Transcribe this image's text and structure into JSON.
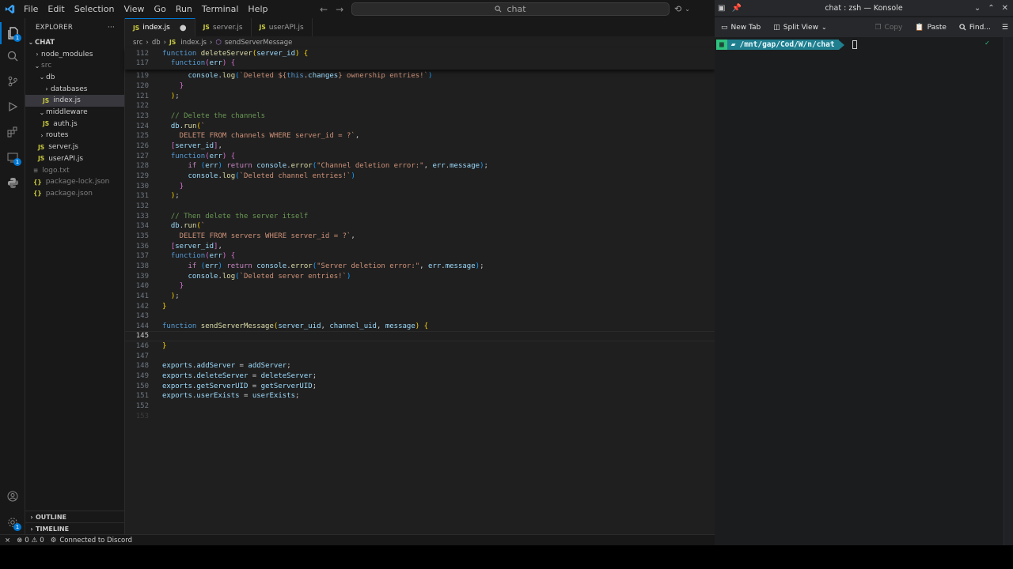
{
  "vscode": {
    "menu": [
      "File",
      "Edit",
      "Selection",
      "View",
      "Go",
      "Run",
      "Terminal",
      "Help"
    ],
    "search": "chat",
    "explorer": {
      "title": "EXPLORER",
      "root": "CHAT",
      "items": [
        {
          "label": "node_modules",
          "kind": "folder",
          "collapsed": true,
          "indent": 1
        },
        {
          "label": "src",
          "kind": "folder",
          "indent": 1,
          "dim": true
        },
        {
          "label": "db",
          "kind": "folder",
          "indent": 2
        },
        {
          "label": "databases",
          "kind": "folder",
          "collapsed": true,
          "indent": 3
        },
        {
          "label": "index.js",
          "kind": "js",
          "indent": 3,
          "selected": true
        },
        {
          "label": "middleware",
          "kind": "folder",
          "indent": 2
        },
        {
          "label": "auth.js",
          "kind": "js",
          "indent": 3
        },
        {
          "label": "routes",
          "kind": "folder",
          "collapsed": true,
          "indent": 2
        },
        {
          "label": "server.js",
          "kind": "js",
          "indent": 2
        },
        {
          "label": "userAPI.js",
          "kind": "js",
          "indent": 2
        },
        {
          "label": "logo.txt",
          "kind": "txt",
          "indent": 1,
          "dim": true
        },
        {
          "label": "package-lock.json",
          "kind": "json",
          "indent": 1,
          "dim": true
        },
        {
          "label": "package.json",
          "kind": "json",
          "indent": 1,
          "dim": true
        }
      ],
      "outline": "OUTLINE",
      "timeline": "TIMELINE"
    },
    "tabs": [
      {
        "label": "index.js",
        "active": true,
        "modified": true
      },
      {
        "label": "server.js",
        "active": false
      },
      {
        "label": "userAPI.js",
        "active": false
      }
    ],
    "breadcrumb": [
      "src",
      "db",
      "index.js",
      "sendServerMessage"
    ],
    "status": {
      "errors": "0",
      "warnings": "0",
      "discord": "Connected to Discord"
    },
    "sticky_lines": [
      {
        "n": "112",
        "html": "<span class='k'>function</span> <span class='fn'>deleteServer</span><span class='p'>(</span><span class='v'>server_id</span><span class='p'>)</span> <span class='p'>{</span>"
      },
      {
        "n": "117",
        "html": "  <span class='k'>function</span><span class='p2'>(</span><span class='v'>err</span><span class='p2'>)</span> <span class='p2'>{</span>"
      }
    ],
    "code_lines": [
      {
        "n": "119",
        "html": "      <span class='v'>console</span>.<span class='fn'>log</span><span class='p3'>(</span><span class='s'>`Deleted ${</span><span class='k'>this</span>.<span class='v'>changes</span><span class='s'>} ownership entries!`</span><span class='p3'>)</span>"
      },
      {
        "n": "120",
        "html": "    <span class='p2'>}</span>"
      },
      {
        "n": "121",
        "html": "  <span class='p'>)</span>;"
      },
      {
        "n": "122",
        "html": ""
      },
      {
        "n": "123",
        "html": "  <span class='c'>// Delete the channels</span>"
      },
      {
        "n": "124",
        "html": "  <span class='v'>db</span>.<span class='fn'>run</span><span class='p'>(</span><span class='s'>`</span>"
      },
      {
        "n": "125",
        "html": "<span class='s'>    DELETE FROM channels WHERE server_id = ?`</span>,"
      },
      {
        "n": "126",
        "html": "  <span class='p2'>[</span><span class='v'>server_id</span><span class='p2'>]</span>,"
      },
      {
        "n": "127",
        "html": "  <span class='k'>function</span><span class='p2'>(</span><span class='v'>err</span><span class='p2'>)</span> <span class='p2'>{</span>"
      },
      {
        "n": "128",
        "html": "      <span class='kc'>if</span> <span class='p3'>(</span><span class='v'>err</span><span class='p3'>)</span> <span class='kc'>return</span> <span class='v'>console</span>.<span class='fn'>error</span><span class='p3'>(</span><span class='s'>\"Channel deletion error:\"</span>, <span class='v'>err</span>.<span class='v'>message</span><span class='p3'>)</span>;"
      },
      {
        "n": "129",
        "html": "      <span class='v'>console</span>.<span class='fn'>log</span><span class='p3'>(</span><span class='s'>`Deleted channel entries!`</span><span class='p3'>)</span>"
      },
      {
        "n": "130",
        "html": "    <span class='p2'>}</span>"
      },
      {
        "n": "131",
        "html": "  <span class='p'>)</span>;"
      },
      {
        "n": "132",
        "html": ""
      },
      {
        "n": "133",
        "html": "  <span class='c'>// Then delete the server itself</span>"
      },
      {
        "n": "134",
        "html": "  <span class='v'>db</span>.<span class='fn'>run</span><span class='p'>(</span><span class='s'>`</span>"
      },
      {
        "n": "135",
        "html": "<span class='s'>    DELETE FROM servers WHERE server_id = ?`</span>,"
      },
      {
        "n": "136",
        "html": "  <span class='p2'>[</span><span class='v'>server_id</span><span class='p2'>]</span>,"
      },
      {
        "n": "137",
        "html": "  <span class='k'>function</span><span class='p2'>(</span><span class='v'>err</span><span class='p2'>)</span> <span class='p2'>{</span>"
      },
      {
        "n": "138",
        "html": "      <span class='kc'>if</span> <span class='p3'>(</span><span class='v'>err</span><span class='p3'>)</span> <span class='kc'>return</span> <span class='v'>console</span>.<span class='fn'>error</span><span class='p3'>(</span><span class='s'>\"Server deletion error:\"</span>, <span class='v'>err</span>.<span class='v'>message</span><span class='p3'>)</span>;"
      },
      {
        "n": "139",
        "html": "      <span class='v'>console</span>.<span class='fn'>log</span><span class='p3'>(</span><span class='s'>`Deleted server entries!`</span><span class='p3'>)</span>"
      },
      {
        "n": "140",
        "html": "    <span class='p2'>}</span>"
      },
      {
        "n": "141",
        "html": "  <span class='p'>)</span>;"
      },
      {
        "n": "142",
        "html": "<span class='p'>}</span>"
      },
      {
        "n": "143",
        "html": ""
      },
      {
        "n": "144",
        "html": "<span class='k'>function</span> <span class='fn'>sendServerMessage</span><span class='p'>(</span><span class='v'>server_uid</span>, <span class='v'>channel_uid</span>, <span class='v'>message</span><span class='p'>)</span> <span class='p'>{</span>"
      },
      {
        "n": "145",
        "html": "",
        "current": true
      },
      {
        "n": "146",
        "html": "<span class='p'>}</span>"
      },
      {
        "n": "147",
        "html": ""
      },
      {
        "n": "148",
        "html": "<span class='v'>exports</span>.<span class='v'>addServer</span> = <span class='v'>addServer</span>;"
      },
      {
        "n": "149",
        "html": "<span class='v'>exports</span>.<span class='v'>deleteServer</span> = <span class='v'>deleteServer</span>;"
      },
      {
        "n": "150",
        "html": "<span class='v'>exports</span>.<span class='v'>getServerUID</span> = <span class='v'>getServerUID</span>;"
      },
      {
        "n": "151",
        "html": "<span class='v'>exports</span>.<span class='v'>userExists</span> = <span class='v'>userExists</span>;"
      },
      {
        "n": "152",
        "html": ""
      },
      {
        "n": "153",
        "html": "",
        "dim": true
      }
    ]
  },
  "konsole": {
    "title": "chat : zsh — Konsole",
    "toolbar": {
      "new_tab": "New Tab",
      "split_view": "Split View",
      "copy": "Copy",
      "paste": "Paste",
      "find": "Find..."
    },
    "prompt_path": "/mnt/gap/Cod/W/n/chat"
  }
}
